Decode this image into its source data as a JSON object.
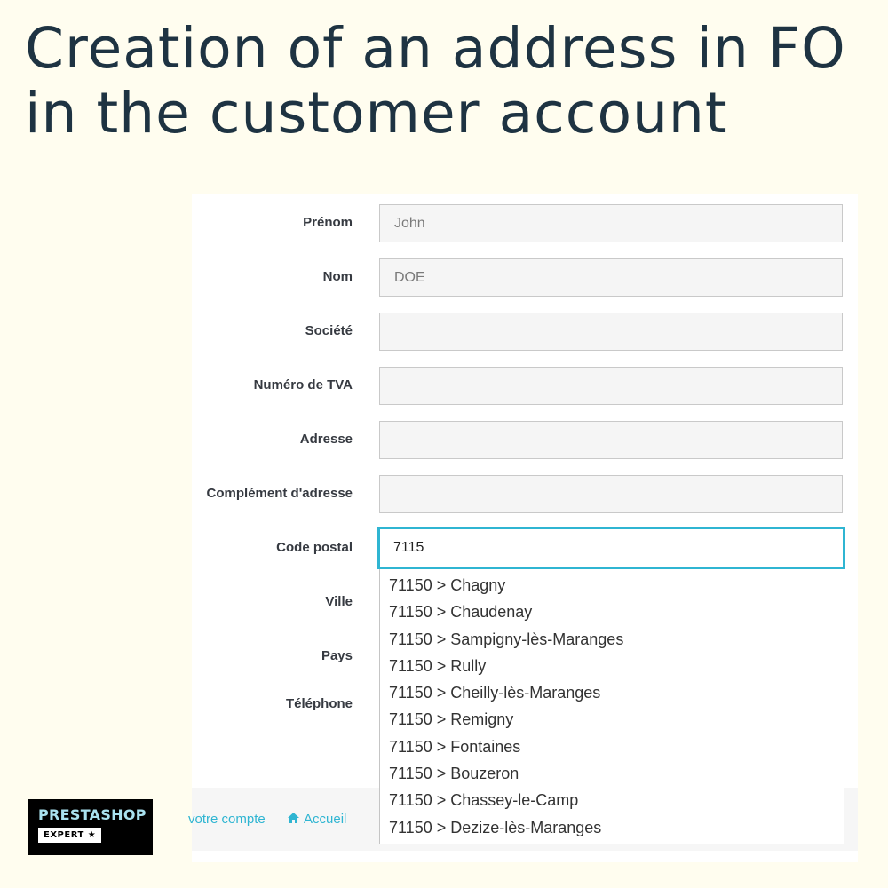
{
  "title": {
    "line1": "Creation of an address in FO",
    "line2": "in the customer account"
  },
  "form": {
    "fields": [
      {
        "label": "Prénom",
        "value": "John"
      },
      {
        "label": "Nom",
        "value": "DOE"
      },
      {
        "label": "Société",
        "value": ""
      },
      {
        "label": "Numéro de TVA",
        "value": ""
      },
      {
        "label": "Adresse",
        "value": ""
      },
      {
        "label": "Complément d'adresse",
        "value": ""
      },
      {
        "label": "Code postal",
        "value": "7115"
      },
      {
        "label": "Ville"
      },
      {
        "label": "Pays"
      },
      {
        "label": "Téléphone"
      }
    ]
  },
  "autocomplete": {
    "options": [
      "71150 > Chagny",
      "71150 > Chaudenay",
      "71150 > Sampigny-lès-Maranges",
      "71150 > Rully",
      "71150 > Cheilly-lès-Maranges",
      "71150 > Remigny",
      "71150 > Fontaines",
      "71150 > Bouzeron",
      "71150 > Chassey-le-Camp",
      "71150 > Dezize-lès-Maranges"
    ]
  },
  "footer": {
    "account_link": "votre compte",
    "home_link": "Accueil",
    "home_icon": "home-icon"
  },
  "logo": {
    "name": "PRESTASHOP",
    "badge": "EXPERT ★"
  },
  "colors": {
    "background": "#fffdef",
    "title": "#1e3342",
    "accent": "#2fb5d2"
  }
}
